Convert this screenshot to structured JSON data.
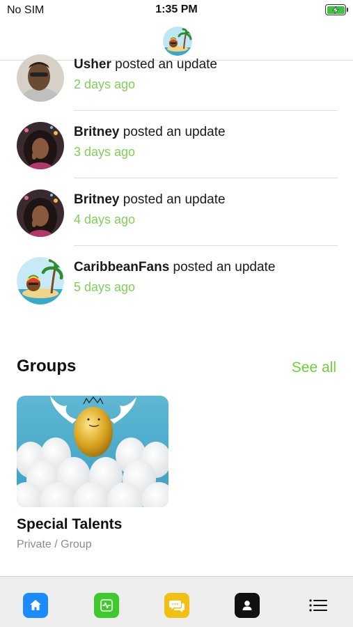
{
  "status_bar": {
    "carrier": "No SIM",
    "time": "1:35 PM",
    "battery_icon": "battery-charging-icon"
  },
  "header": {
    "logo_icon": "caribbean-island-logo-icon"
  },
  "feed": {
    "items": [
      {
        "author": "Usher",
        "action": " posted an update",
        "time": "2 days ago",
        "avatar": "person-avatar"
      },
      {
        "author": "Britney",
        "action": " posted an update",
        "time": "3 days ago",
        "avatar": "person-avatar"
      },
      {
        "author": "Britney",
        "action": " posted an update",
        "time": "4 days ago",
        "avatar": "person-avatar"
      },
      {
        "author": "CaribbeanFans",
        "action": " posted an update",
        "time": "5 days ago",
        "avatar": "caribbean-island-avatar"
      }
    ]
  },
  "groups": {
    "title": "Groups",
    "see_all": "See all",
    "cards": [
      {
        "name": "Special Talents",
        "meta": "Private / Group",
        "image": "golden-egg-with-wings-image"
      }
    ]
  },
  "tab_bar": {
    "tabs": [
      {
        "icon": "home-icon",
        "color": "#1a8cff"
      },
      {
        "icon": "activity-icon",
        "color": "#3ec92c"
      },
      {
        "icon": "chat-bubbles-icon",
        "color": "#f2c012"
      },
      {
        "icon": "profile-icon",
        "color": "#111111"
      },
      {
        "icon": "menu-icon",
        "color": "#111111"
      }
    ]
  },
  "colors": {
    "accent_green": "#6fcf3c",
    "timestamp_green": "#7dd157"
  }
}
